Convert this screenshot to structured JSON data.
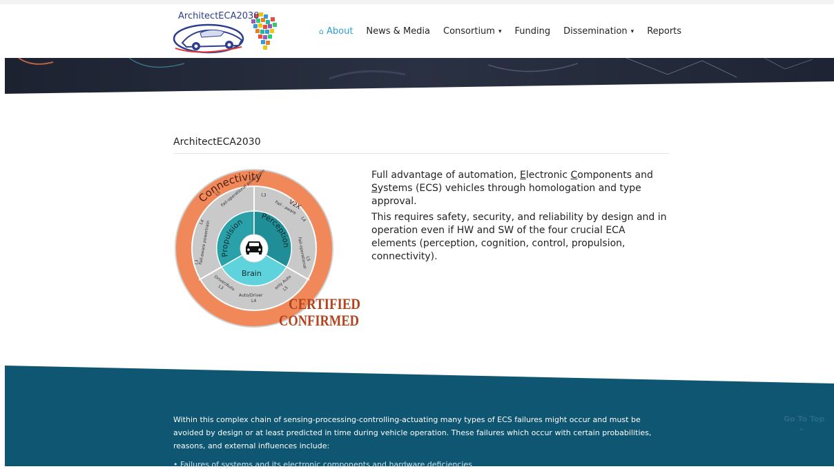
{
  "header": {
    "logo_text": "ArchitectECA2030",
    "nav": [
      {
        "label": "About",
        "icon": "home-icon",
        "active": true
      },
      {
        "label": "News & Media"
      },
      {
        "label": "Consortium",
        "dropdown": true
      },
      {
        "label": "Funding"
      },
      {
        "label": "Dissemination",
        "dropdown": true
      },
      {
        "label": "Reports"
      }
    ]
  },
  "content": {
    "title": "ArchitectECA2030",
    "paragraph1": {
      "before_e": "Full advantage of automation, ",
      "e": "E",
      "after_e": "lectronic ",
      "c": "C",
      "after_c": "omponents and ",
      "s": "S",
      "after_s": "ystems (ECS) vehicles through homologation and type approval."
    },
    "paragraph2": "This requires safety, security, and reliability by design and in operation even if HW and SW of the four crucial ECA elements (perception, cognition, control, propulsion, connectivity)."
  },
  "diagram": {
    "outer_label": "Connectivity",
    "v2x": "V2X",
    "segments": [
      "Propulsion",
      "Perception",
      "Brain"
    ],
    "middle_labels": {
      "top_left": "Fail-operational powertrain",
      "top_left_level": "L5",
      "left_upper_level": "L4",
      "left": "Fail-aware powertrain",
      "left_level": "L3",
      "top_right": "Fail - aware",
      "top_right_level_a": "L3",
      "top_right_level_b": "L4",
      "right": "Fail-operational",
      "right_level": "L5",
      "bottom_left": "Driver/Auto",
      "bottom_left_level": "L3",
      "bottom": "Auto/Driver",
      "bottom_level": "L4",
      "bottom_right": "only Auto",
      "bottom_right_level": "L5"
    },
    "stamp_line1": "CERTIFIED",
    "stamp_line2": "CONFIRMED"
  },
  "footer": {
    "text": "Within this complex chain of sensing-processing-controlling-actuating many types of ECS failures might occur and must be avoided by design or at least predicted in time during vehicle operation. These failures which occur with certain probabilities, reasons, and external influences include:",
    "bullet": "Failures of systems and its electronic components and hardware deficiencies",
    "go_to_top": "Go To Top"
  },
  "colors": {
    "accent": "#2a9fd6",
    "footer_bg": "#0e5672",
    "ring_outer": "#f0885a",
    "ring_middle": "#c9c9c9",
    "ring_inner_dark": "#2aa0a8",
    "ring_inner_light": "#5fd3db",
    "stamp": "#b3431c"
  }
}
